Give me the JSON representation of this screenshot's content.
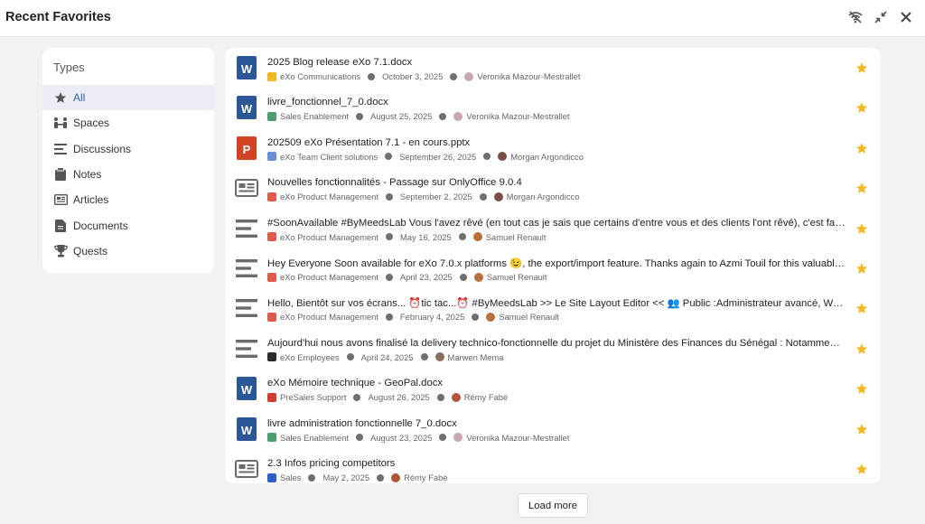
{
  "header": {
    "title": "Recent Favorites",
    "actions": [
      {
        "name": "connection-status-icon",
        "icon": "wifi-off"
      },
      {
        "name": "collapse-icon",
        "icon": "collapse"
      },
      {
        "name": "close-icon",
        "icon": "close"
      }
    ]
  },
  "sidebar": {
    "title": "Types",
    "items": [
      {
        "label": "All",
        "icon": "star",
        "active": true
      },
      {
        "label": "Spaces",
        "icon": "spaces"
      },
      {
        "label": "Discussions",
        "icon": "discussions"
      },
      {
        "label": "Notes",
        "icon": "notes"
      },
      {
        "label": "Articles",
        "icon": "articles"
      },
      {
        "label": "Documents",
        "icon": "documents"
      },
      {
        "label": "Quests",
        "icon": "trophy"
      }
    ]
  },
  "favorites": [
    {
      "title": "2025 Blog release eXo 7.1.docx",
      "type": "word",
      "space": "eXo Communications",
      "space_color": "#f2b824",
      "date": "October 3, 2025",
      "author": "Veronika Mazour-Mestrallet",
      "avatar_color": "#c9a7b0"
    },
    {
      "title": "livre_fonctionnel_7_0.docx",
      "type": "word",
      "space": "Sales Enablement",
      "space_color": "#4a9d6b",
      "date": "August 25, 2025",
      "author": "Veronika Mazour-Mestrallet",
      "avatar_color": "#c9a7b0"
    },
    {
      "title": "202509 eXo Présentation 7.1 - en cours.pptx",
      "type": "powerpoint",
      "space": "eXo Team Client solutions",
      "space_color": "#6a8fd6",
      "date": "September 26, 2025",
      "author": "Morgan Argondicco",
      "avatar_color": "#7a4f44"
    },
    {
      "title": "Nouvelles fonctionnalités - Passage sur OnlyOffice 9.0.4",
      "type": "article",
      "space": "eXo Product Management",
      "space_color": "#e05a4a",
      "date": "September 2, 2025",
      "author": "Morgan Argondicco",
      "avatar_color": "#7a4f44"
    },
    {
      "title": "#SoonAvailable #ByMeedsLab   Vous l'avez rêvé (en tout cas je sais que certains d'entre vous et des clients l'ont rêvé), c'est fait ! Grâce au dernier travail de l'équipe",
      "type": "note",
      "space": "eXo Product Management",
      "space_color": "#e05a4a",
      "date": "May 16, 2025",
      "author": "Samuel Renault",
      "avatar_color": "#b5703c"
    },
    {
      "title": "Hey Everyone   Soon available for eXo 7.0.x platforms 😉, the export/import feature.   Thanks again to Azmi Touil for this valuable contribution",
      "type": "note",
      "space": "eXo Product Management",
      "space_color": "#e05a4a",
      "date": "April 23, 2025",
      "author": "Samuel Renault",
      "avatar_color": "#b5703c"
    },
    {
      "title": "Hello,   Bientôt sur vos écrans... ⏰tic tac...⏰ #ByMeedsLab   >> Le Site Layout Editor <<   👥 Public :Administrateur avancé, Webmaster",
      "type": "note",
      "space": "eXo Product Management",
      "space_color": "#e05a4a",
      "date": "February 4, 2025",
      "author": "Samuel Renault",
      "avatar_color": "#b5703c"
    },
    {
      "title": "Aujourd'hui nous avons finalisé la delivery technico-fonctionnelle du projet du Ministère des Finances du Sénégal : Notamment la mise en place",
      "type": "note",
      "space": "eXo Employees",
      "space_color": "#2b2b2b",
      "date": "April 24, 2025",
      "author": "Marwen Mema",
      "avatar_color": "#8a6e5c"
    },
    {
      "title": "eXo Mémoire technique - GeoPal.docx",
      "type": "word",
      "space": "PreSales Support",
      "space_color": "#d23b2c",
      "date": "August 26, 2025",
      "author": "Rémy Fabé",
      "avatar_color": "#b0553a"
    },
    {
      "title": "livre administration fonctionnelle 7_0.docx",
      "type": "word",
      "space": "Sales Enablement",
      "space_color": "#4a9d6b",
      "date": "August 23, 2025",
      "author": "Veronika Mazour-Mestrallet",
      "avatar_color": "#c9a7b0"
    },
    {
      "title": "2.3 Infos pricing competitors",
      "type": "article",
      "space": "Sales",
      "space_color": "#2f5fc9",
      "date": "May 2, 2025",
      "author": "Rémy Fabé",
      "avatar_color": "#b0553a"
    }
  ],
  "load_more_label": "Load more",
  "colors": {
    "accent": "#3c62a8",
    "star": "#f6b821",
    "word": "#2b5797",
    "powerpoint": "#d04423",
    "icon_gray": "#6b6b6b"
  }
}
